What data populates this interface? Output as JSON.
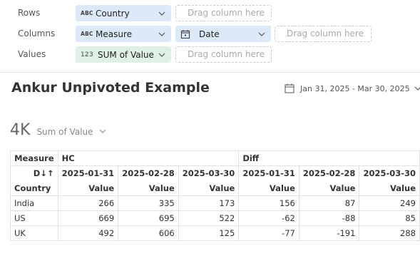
{
  "config": {
    "rows": {
      "label": "Rows",
      "pills": [
        {
          "type": "ABC",
          "label": "Country"
        }
      ],
      "dropzone": "Drag column here"
    },
    "columns": {
      "label": "Columns",
      "pills": [
        {
          "type": "ABC",
          "label": "Measure"
        },
        {
          "type": "date",
          "label": "Date"
        }
      ],
      "dropzone": "Drag column here"
    },
    "values": {
      "label": "Values",
      "pills": [
        {
          "type": "123",
          "label": "SUM of Value"
        }
      ],
      "dropzone": "Drag column here"
    }
  },
  "header": {
    "title": "Ankur Unpivoted Example",
    "date_range": "Jan 31, 2025 - Mar 30, 2025"
  },
  "metric": {
    "value": "4K",
    "label": "Sum of Value"
  },
  "table": {
    "measure_label": "Measure",
    "date_label": "D↓↑",
    "row_header": "Country",
    "groups": [
      "HC",
      "Diff"
    ],
    "dates": [
      "2025-01-31",
      "2025-02-28",
      "2025-03-30",
      "2025-01-31",
      "2025-02-28",
      "2025-03-30"
    ],
    "value_label": "Value",
    "rows": [
      {
        "country": "India",
        "values": [
          "266",
          "335",
          "173",
          "156",
          "87",
          "249"
        ]
      },
      {
        "country": "US",
        "values": [
          "669",
          "695",
          "522",
          "-62",
          "-88",
          "85"
        ]
      },
      {
        "country": "UK",
        "values": [
          "492",
          "606",
          "125",
          "-77",
          "-191",
          "288"
        ]
      }
    ]
  },
  "colors": {
    "pill_blue": "#dce9f9",
    "pill_green": "#dff0e6"
  }
}
